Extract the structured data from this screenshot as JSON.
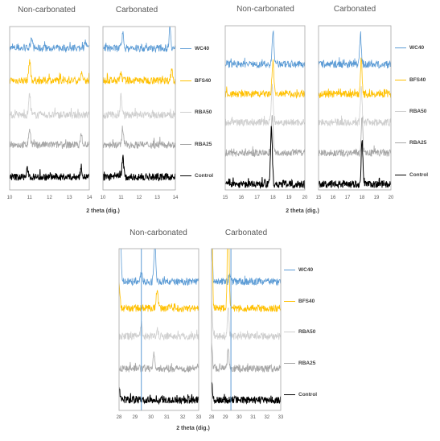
{
  "xlabel": "2 theta (dig.)",
  "series_names": [
    "WC40",
    "BFS40",
    "RBA50",
    "RBA25",
    "Control"
  ],
  "colors": {
    "WC40": "#5b9bd5",
    "BFS40": "#ffc000",
    "RBA50": "#cfcfcf",
    "RBA25": "#a6a6a6",
    "Control": "#000000",
    "reference_line": "#5b9bd5",
    "frame": "#a6a6a6"
  },
  "groups": [
    {
      "titles": [
        "Non-carbonated",
        "Carbonated"
      ],
      "xlabel": "2 theta (dig.)"
    },
    {
      "titles": [
        "Non-carbonated",
        "Carbonated"
      ],
      "xlabel": "2 theta (dig.)"
    },
    {
      "titles": [
        "Non-carbonated",
        "Carbonated"
      ],
      "xlabel": "2 theta (dig.)"
    }
  ],
  "chart_data": [
    {
      "type": "line",
      "group": 0,
      "title": "Non-carbonated",
      "xlabel": "2 theta (dig.)",
      "xlim": [
        10,
        14
      ],
      "xticks": [
        10,
        11,
        12,
        13,
        14
      ],
      "y_axis": "none, stacked offset patterns (a.u.)",
      "grid": false,
      "legend": "right",
      "series": [
        {
          "name": "WC40",
          "peaks": [
            [
              11.1,
              15
            ],
            [
              13.8,
              8
            ]
          ]
        },
        {
          "name": "BFS40",
          "peaks": [
            [
              11.0,
              25
            ],
            [
              13.6,
              8
            ]
          ]
        },
        {
          "name": "RBA50",
          "peaks": [
            [
              11.0,
              25
            ]
          ]
        },
        {
          "name": "RBA25",
          "peaks": [
            [
              11.0,
              20
            ],
            [
              13.6,
              12
            ]
          ]
        },
        {
          "name": "Control",
          "peaks": [
            [
              10.9,
              10
            ],
            [
              13.6,
              12
            ]
          ]
        }
      ],
      "reference_lines": []
    },
    {
      "type": "line",
      "group": 0,
      "title": "Carbonated",
      "xlabel": "2 theta (dig.)",
      "xlim": [
        10,
        14
      ],
      "xticks": [
        10,
        11,
        12,
        13,
        14
      ],
      "y_axis": "none, stacked offset patterns (a.u.)",
      "grid": false,
      "legend": "right",
      "series": [
        {
          "name": "WC40",
          "peaks": [
            [
              11.1,
              18
            ],
            [
              13.7,
              28
            ]
          ]
        },
        {
          "name": "BFS40",
          "peaks": [
            [
              11.0,
              10
            ],
            [
              13.8,
              15
            ]
          ]
        },
        {
          "name": "RBA50",
          "peaks": [
            [
              11.0,
              25
            ]
          ]
        },
        {
          "name": "RBA25",
          "peaks": [
            [
              11.1,
              18
            ]
          ]
        },
        {
          "name": "Control",
          "peaks": [
            [
              11.1,
              25
            ]
          ]
        }
      ],
      "reference_lines": []
    },
    {
      "type": "line",
      "group": 1,
      "title": "Non-carbonated",
      "xlabel": "2 theta (dig.)",
      "xlim": [
        15,
        20
      ],
      "xticks": [
        15,
        16,
        17,
        18,
        19,
        20
      ],
      "y_axis": "none, stacked offset patterns (a.u.)",
      "grid": false,
      "legend": "right",
      "series": [
        {
          "name": "WC40",
          "peaks": [
            [
              18.0,
              40
            ]
          ]
        },
        {
          "name": "BFS40",
          "peaks": [
            [
              18.0,
              40
            ]
          ]
        },
        {
          "name": "RBA50",
          "peaks": [
            [
              17.95,
              45
            ]
          ]
        },
        {
          "name": "RBA25",
          "peaks": [
            [
              17.95,
              50
            ]
          ]
        },
        {
          "name": "Control",
          "peaks": [
            [
              17.9,
              70
            ]
          ]
        }
      ],
      "reference_lines": []
    },
    {
      "type": "line",
      "group": 1,
      "title": "Carbonated",
      "xlabel": "2 theta (dig.)",
      "xlim": [
        15,
        20
      ],
      "xticks": [
        15,
        16,
        17,
        18,
        19,
        20
      ],
      "y_axis": "none, stacked offset patterns (a.u.)",
      "grid": false,
      "legend": "right",
      "series": [
        {
          "name": "WC40",
          "peaks": [
            [
              17.9,
              35
            ]
          ]
        },
        {
          "name": "BFS40",
          "peaks": [
            [
              17.95,
              45
            ]
          ]
        },
        {
          "name": "RBA50",
          "peaks": [
            [
              17.95,
              45
            ]
          ]
        },
        {
          "name": "RBA25",
          "peaks": [
            [
              18.0,
              45
            ]
          ]
        },
        {
          "name": "Control",
          "peaks": [
            [
              18.0,
              55
            ]
          ]
        }
      ],
      "reference_lines": []
    },
    {
      "type": "line",
      "group": 2,
      "title": "Non-carbonated",
      "xlabel": "2 theta (dig.)",
      "xlim": [
        28,
        33
      ],
      "xticks": [
        28,
        29,
        30,
        31,
        32,
        33
      ],
      "y_axis": "none, stacked offset patterns (a.u.)",
      "grid": false,
      "legend": "right",
      "series": [
        {
          "name": "WC40",
          "peaks": [
            [
              28.05,
              100
            ],
            [
              29.4,
              10
            ],
            [
              30.25,
              45
            ]
          ]
        },
        {
          "name": "BFS40",
          "peaks": [
            [
              28.0,
              30
            ],
            [
              30.4,
              25
            ]
          ]
        },
        {
          "name": "RBA50",
          "peaks": [
            [
              29.4,
              12
            ],
            [
              30.4,
              10
            ]
          ]
        },
        {
          "name": "RBA25",
          "peaks": [
            [
              30.2,
              20
            ]
          ]
        },
        {
          "name": "Control",
          "peaks": [
            [
              28.0,
              15
            ]
          ]
        }
      ],
      "reference_lines": [
        29.4
      ]
    },
    {
      "type": "line",
      "group": 2,
      "title": "Carbonated",
      "xlabel": "2 theta (dig.)",
      "xlim": [
        28,
        33
      ],
      "xticks": [
        28,
        29,
        30,
        31,
        32,
        33
      ],
      "y_axis": "none, stacked offset patterns (a.u.)",
      "grid": false,
      "legend": "right",
      "series": [
        {
          "name": "WC40",
          "peaks": [
            [
              28.0,
              60
            ],
            [
              29.3,
              10
            ]
          ]
        },
        {
          "name": "BFS40",
          "peaks": [
            [
              28.0,
              150
            ],
            [
              29.2,
              150
            ]
          ]
        },
        {
          "name": "RBA50",
          "peaks": [
            [
              28.0,
              40
            ],
            [
              29.2,
              35
            ]
          ]
        },
        {
          "name": "RBA25",
          "peaks": [
            [
              28.0,
              30
            ],
            [
              29.2,
              25
            ]
          ]
        },
        {
          "name": "Control",
          "peaks": [
            [
              28.0,
              25
            ]
          ]
        }
      ],
      "reference_lines": [
        29.4
      ]
    }
  ]
}
